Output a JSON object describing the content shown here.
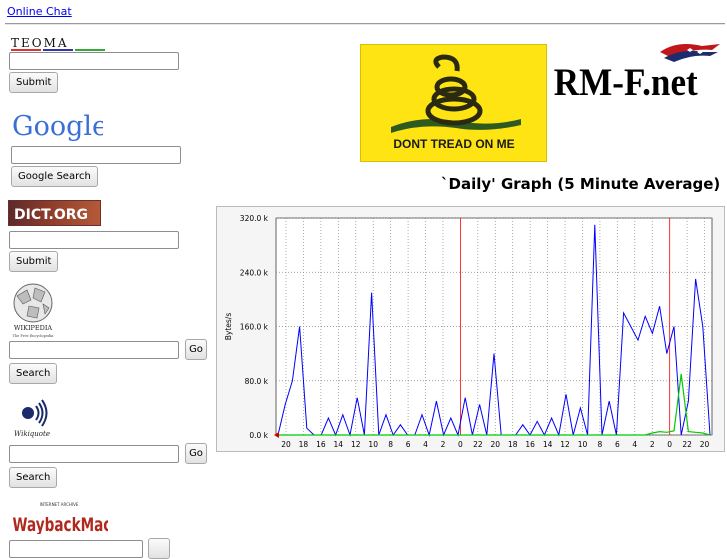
{
  "top_link": "Online Chat",
  "engines": {
    "teoma": {
      "logo": "TEOMA",
      "submit_label": "Submit"
    },
    "google": {
      "logo": "Google",
      "submit_label": "Google Search"
    },
    "dict": {
      "logo": "DICT.ORG",
      "submit_label": "Submit"
    },
    "wikipedia": {
      "logo_main": "WIKIPEDIA",
      "logo_sub": "The Free Encyclopedia",
      "go_label": "Go",
      "search_label": "Search"
    },
    "wikiquote": {
      "logo": "Wikiquote",
      "go_label": "Go",
      "search_label": "Search"
    },
    "wayback": {
      "logo_top": "INTERNET ARCHIVE",
      "logo_main": "WaybackMachine"
    }
  },
  "flag": {
    "caption": "DONT TREAD ON ME"
  },
  "site_logo": "RM-F.net",
  "graph": {
    "title": "`Daily' Graph (5 Minute Average)",
    "chart_data": {
      "type": "line",
      "title": "`Daily' Graph (5 Minute Average)",
      "ylabel": "Bytes/s",
      "ylim": [
        0,
        320000
      ],
      "y_ticks": [
        "320.0 k",
        "240.0 k",
        "160.0 k",
        "80.0 k",
        "0.0 k"
      ],
      "x_tick_labels": [
        "20",
        "18",
        "16",
        "14",
        "12",
        "10",
        "8",
        "6",
        "4",
        "2",
        "0",
        "22",
        "20",
        "18",
        "16",
        "14",
        "12",
        "10",
        "8",
        "6",
        "4",
        "2",
        "0",
        "22",
        "20"
      ],
      "series": [
        {
          "color": "#0000ff",
          "values": [
            0,
            45,
            80,
            160,
            10,
            0,
            0,
            25,
            0,
            30,
            0,
            55,
            0,
            210,
            0,
            30,
            0,
            15,
            0,
            0,
            30,
            0,
            50,
            0,
            25,
            0,
            55,
            0,
            45,
            0,
            120,
            0,
            0,
            0,
            15,
            0,
            20,
            0,
            25,
            0,
            60,
            0,
            40,
            0,
            310,
            0,
            50,
            0,
            180,
            160,
            140,
            175,
            150,
            190,
            120,
            160,
            0,
            50,
            230,
            160,
            0
          ]
        },
        {
          "color": "#00cc00",
          "values": [
            0,
            0,
            0,
            0,
            0,
            0,
            0,
            0,
            0,
            0,
            0,
            0,
            0,
            0,
            0,
            0,
            0,
            0,
            0,
            0,
            0,
            0,
            0,
            0,
            0,
            0,
            0,
            0,
            0,
            0,
            0,
            0,
            0,
            0,
            0,
            0,
            0,
            0,
            0,
            0,
            0,
            0,
            0,
            0,
            0,
            0,
            0,
            0,
            0,
            0,
            0,
            0,
            3,
            5,
            4,
            6,
            90,
            5,
            4,
            3,
            0
          ]
        }
      ]
    }
  },
  "colors": {
    "flag_yellow": "#ffe413",
    "graph_blue": "#0000ff",
    "graph_green": "#00cc00",
    "day_marker": "#ff0000"
  }
}
